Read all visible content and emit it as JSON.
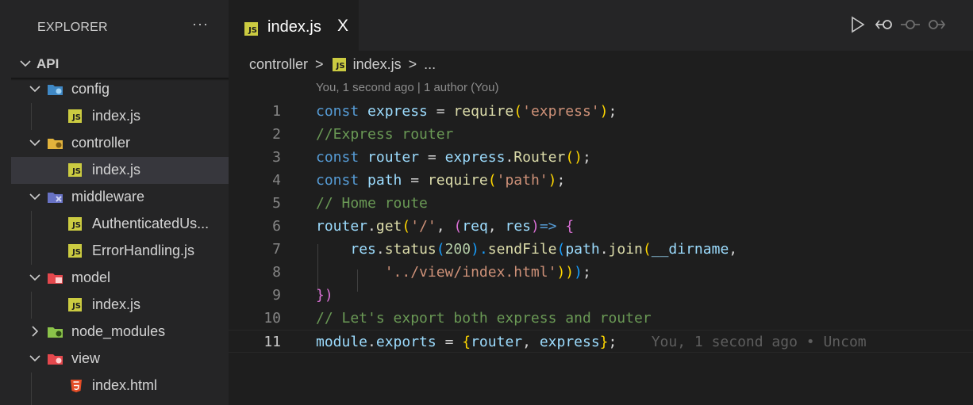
{
  "explorer": {
    "title": "EXPLORER",
    "more": "···",
    "root": "API",
    "items": [
      {
        "label": "config",
        "kind": "folder",
        "expanded": true
      },
      {
        "label": "index.js",
        "kind": "file"
      },
      {
        "label": "controller",
        "kind": "folder",
        "expanded": true
      },
      {
        "label": "index.js",
        "kind": "file",
        "selected": true
      },
      {
        "label": "middleware",
        "kind": "folder",
        "expanded": true
      },
      {
        "label": "AuthenticatedUs...",
        "kind": "file"
      },
      {
        "label": "ErrorHandling.js",
        "kind": "file"
      },
      {
        "label": "model",
        "kind": "folder",
        "expanded": true
      },
      {
        "label": "index.js",
        "kind": "file"
      },
      {
        "label": "node_modules",
        "kind": "folder",
        "expanded": false
      },
      {
        "label": "view",
        "kind": "folder",
        "expanded": true
      },
      {
        "label": "index.html",
        "kind": "html"
      }
    ]
  },
  "tab": {
    "label": "index.js",
    "badge": "JS",
    "close": "X"
  },
  "breadcrumb": {
    "folder": "controller",
    "sep": ">",
    "file": "index.js",
    "sep2": ">",
    "rest": "..."
  },
  "codelens": "You, 1 second ago | 1 author (You)",
  "line_numbers": [
    "1",
    "2",
    "3",
    "4",
    "5",
    "6",
    "7",
    "8",
    "9",
    "10",
    "11"
  ],
  "code": {
    "l1": {
      "a": "const",
      "b": "express",
      "c": " = ",
      "d": "require",
      "e": "(",
      "f": "'express'",
      "g": ")",
      "h": ";"
    },
    "l2": {
      "a": "//Express router"
    },
    "l3": {
      "a": "const",
      "b": "router",
      "c": " = ",
      "d": "express",
      "e": ".",
      "f": "Router",
      "g": "()",
      "h": ";"
    },
    "l4": {
      "a": "const",
      "b": "path",
      "c": " = ",
      "d": "require",
      "e": "(",
      "f": "'path'",
      "g": ")",
      "h": ";"
    },
    "l5": {
      "a": "// Home route"
    },
    "l6": {
      "a": "router",
      "b": ".",
      "c": "get",
      "d": "(",
      "e": "'/'",
      "f": ", ",
      "g": "(",
      "h": "req",
      "i": ", ",
      "j": "res",
      "k": ")",
      "l": "=>",
      "m": " ",
      "n": "{"
    },
    "l7": {
      "a": "res",
      "b": ".",
      "c": "status",
      "d": "(",
      "e": "200",
      "f": ").",
      "g": "sendFile",
      "h": "(",
      "i": "path",
      "j": ".",
      "k": "join",
      "l": "(",
      "m": "__dirname",
      "n": ","
    },
    "l8": {
      "a": "'../view/index.html'",
      "b": "))",
      "c": ")",
      "d": ";"
    },
    "l9": {
      "a": "})"
    },
    "l10": {
      "a": "// Let's export both express and router"
    },
    "l11": {
      "a": "module",
      "b": ".",
      "c": "exports",
      "d": " = ",
      "e": "{",
      "f": "router",
      "g": ", ",
      "h": "express",
      "i": "}",
      "j": ";"
    }
  },
  "blame": "You, 1 second ago • Uncom",
  "colors": {
    "sidebar_bg": "#252526",
    "editor_bg": "#1e1e1e",
    "selection": "#37373d",
    "js_badge": "#cbcb41",
    "keyword": "#569cd6",
    "variable": "#9cdcfe",
    "function": "#dcdcaa",
    "string": "#ce9178",
    "comment": "#6a9955"
  },
  "icons": [
    "chevron-down-icon",
    "chevron-right-icon",
    "folder-config-icon",
    "folder-controller-icon",
    "folder-middleware-icon",
    "folder-model-icon",
    "folder-node-modules-icon",
    "folder-view-icon",
    "js-file-icon",
    "html-file-icon",
    "run-icon",
    "go-back-icon",
    "timeline-icon",
    "compare-icon"
  ]
}
